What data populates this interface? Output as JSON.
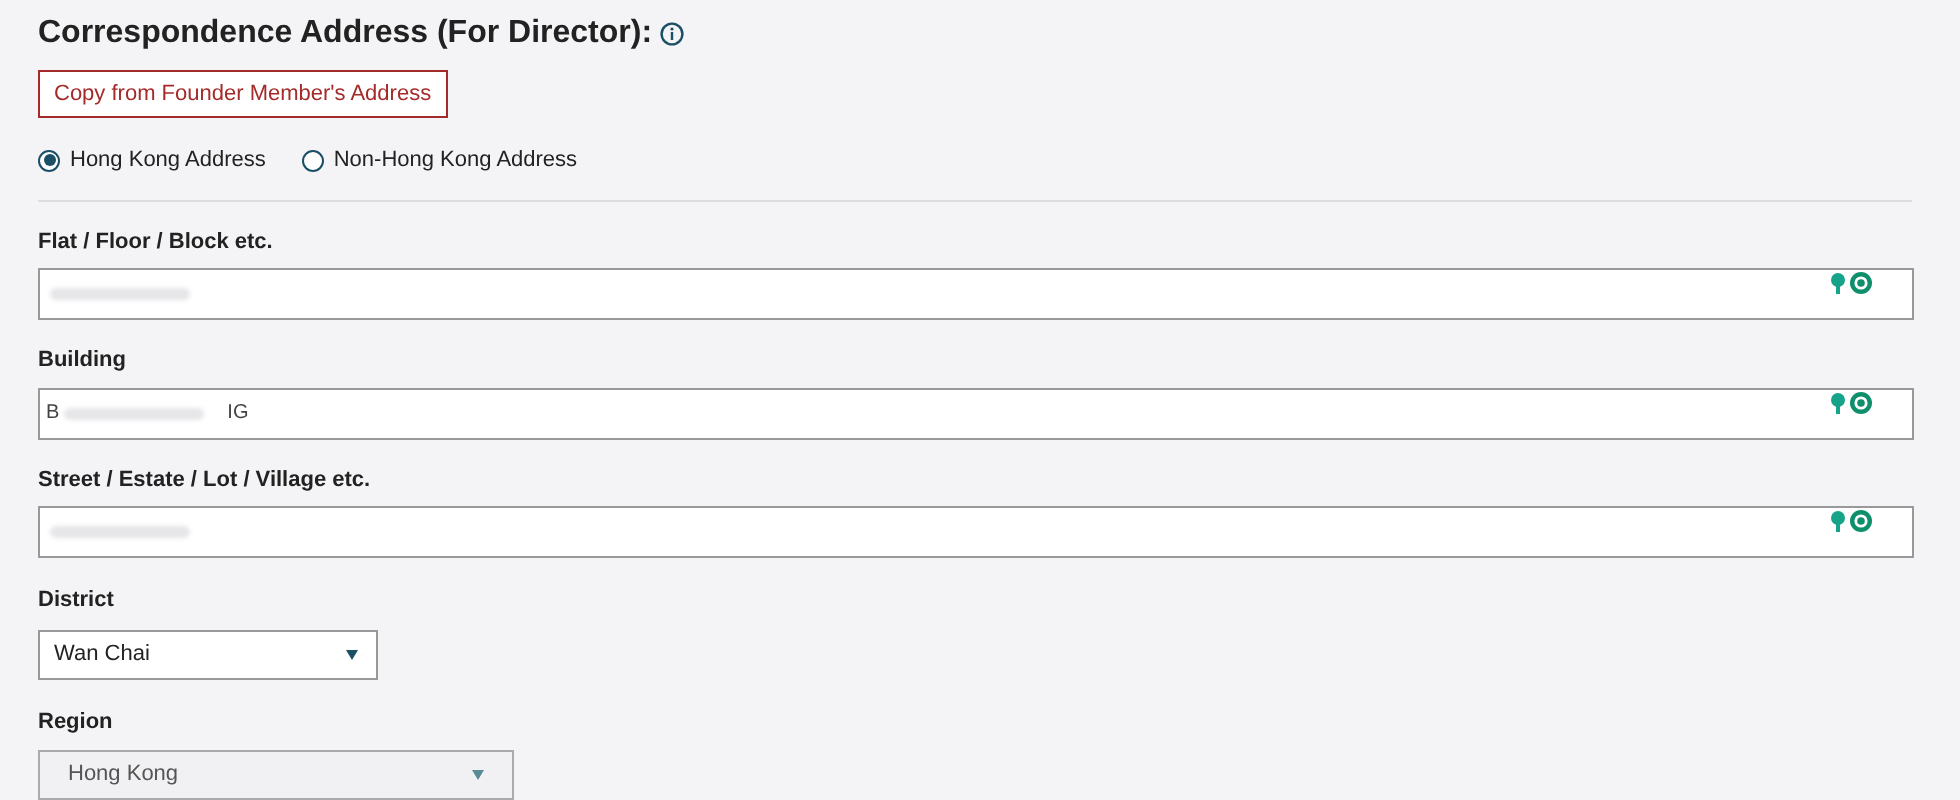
{
  "heading": {
    "title": "Correspondence Address (For Director):"
  },
  "copy_button": {
    "label": "Copy from Founder Member's Address"
  },
  "address_type": [
    {
      "label": "Hong Kong Address",
      "selected": true
    },
    {
      "label": "Non-Hong Kong Address",
      "selected": false
    }
  ],
  "text_fields": [
    {
      "label": "Flat / Floor / Block etc.",
      "redacted": true
    },
    {
      "label": "Building",
      "value_start": "B",
      "value_end": "IG",
      "redacted": true
    },
    {
      "label": "Street / Estate / Lot / Village etc.",
      "redacted": true
    }
  ],
  "selects": [
    {
      "label": "District",
      "value": "Wan Chai",
      "disabled": false
    },
    {
      "label": "Region",
      "value": "Hong Kong",
      "disabled": true
    }
  ]
}
